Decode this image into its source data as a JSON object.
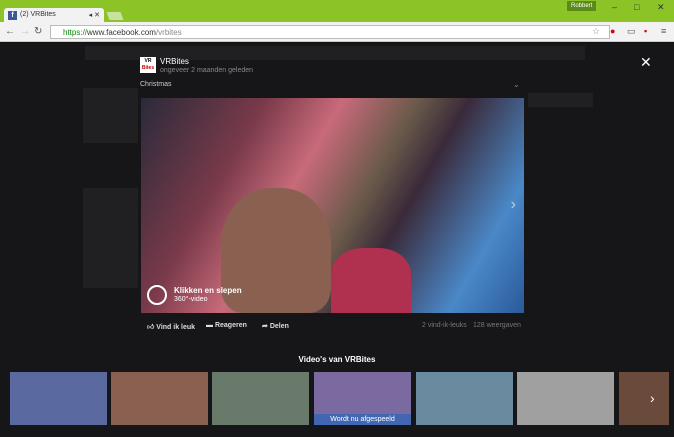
{
  "browser": {
    "tab_title": "(2) VRBites",
    "user": "Robbert",
    "url_scheme": "https://",
    "url_host": "www.facebook.com",
    "url_path": "/vrbites"
  },
  "post": {
    "page_name": "VRBites",
    "logo_line1": "VR",
    "logo_line2": "Bites",
    "time": "ongeveer 2 maanden geleden",
    "title": "Christmas"
  },
  "video": {
    "overlay_title": "Klikken en slepen",
    "overlay_sub": "360°-video"
  },
  "actions": {
    "like": "Vind ik leuk",
    "comment": "Reageren",
    "share": "Delen",
    "likes": "2 vind-ik-leuks",
    "views": "128 weergaven"
  },
  "related": {
    "heading": "Video's van VRBites",
    "now_playing": "Wordt nu afgespeeld",
    "colors": [
      "#5a6aa0",
      "#8a6050",
      "#6a7a6a",
      "#7a6aa0",
      "#6a8aa0",
      "#a0a0a0",
      "#6a4a3a"
    ]
  }
}
